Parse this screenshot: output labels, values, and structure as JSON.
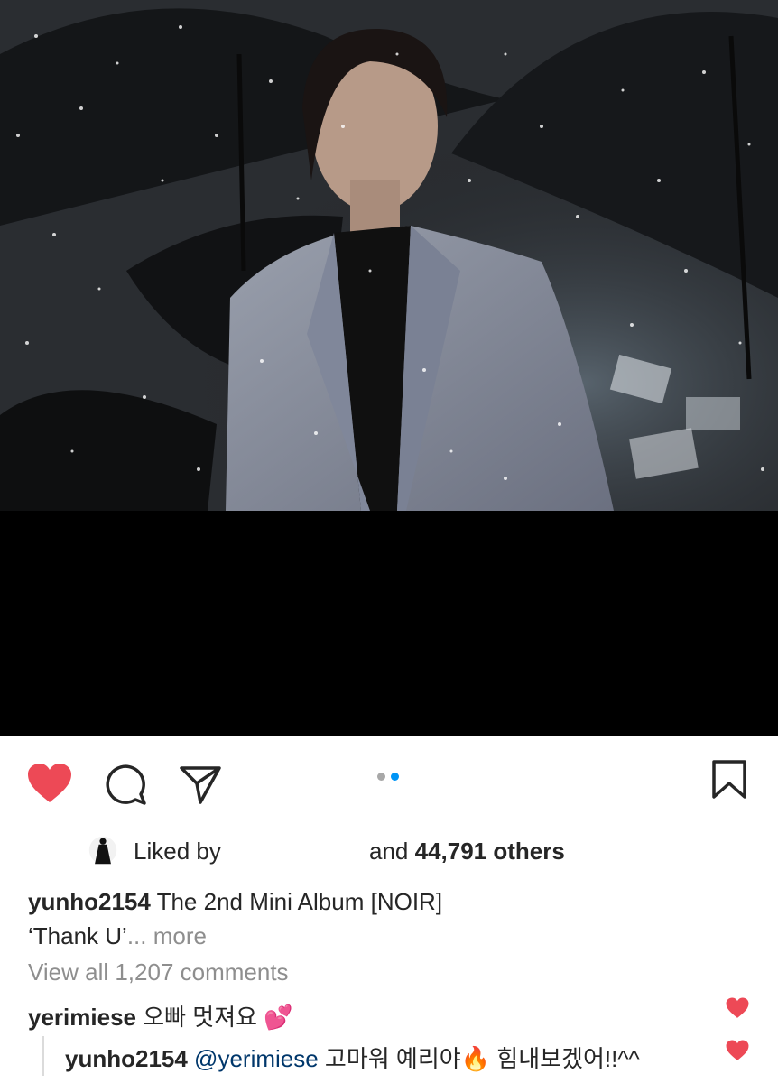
{
  "post": {
    "image_alt": "Man in grey suit standing in rain among black umbrellas",
    "carousel_count": 2,
    "carousel_active": 2
  },
  "actions": {
    "liked": true,
    "icons": [
      "heart-icon",
      "comment-icon",
      "share-icon",
      "bookmark-icon"
    ],
    "like_color": "#ed4956"
  },
  "likes": {
    "liked_by": "Liked by",
    "and_text": "and ",
    "count_text": "44,791 others"
  },
  "caption": {
    "username": "yunho2154",
    "text_line1": " The 2nd Mini Album [NOIR]",
    "text_line2": "‘Thank U’",
    "more": "... more"
  },
  "comments_link": "View all 1,207 comments",
  "comments": [
    {
      "username": "yerimiese",
      "text": " 오빠 멋져요 ",
      "emoji": "💕"
    },
    {
      "username": "yunho2154",
      "mention": " @yerimiese",
      "text": " 고마워 예리야",
      "emoji": "🔥",
      "text2": " 힘내보겠어!!^^"
    }
  ],
  "colors": {
    "link": "#00376b",
    "muted": "#8e8e8e",
    "dot_active": "#0095f6",
    "dot_inactive": "#a8a8a8"
  }
}
